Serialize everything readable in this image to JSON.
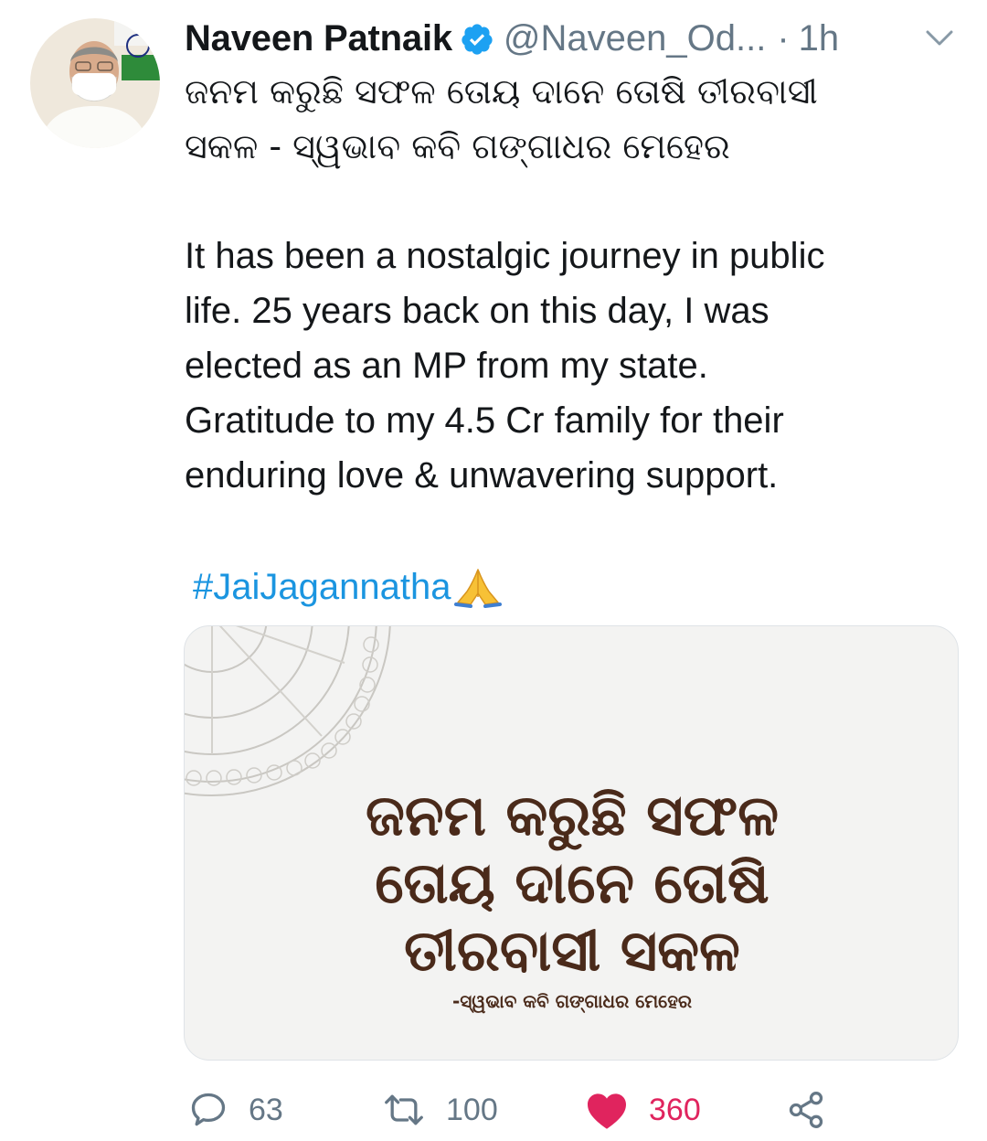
{
  "author": {
    "name": "Naveen Patnaik",
    "handle": "@Naveen_Od...",
    "separator": "·",
    "time": "1h",
    "verified": true
  },
  "tweet": {
    "odia_lines": [
      "ଜନମ କରୁଛି ସଫଳ ତୋୟ ଦାନେ ତୋଷି ତୀରବାସୀ",
      "ସକଳ - ସ୍ୱଭାବ କବି ଗଙ୍ଗାଧର ମେହେର"
    ],
    "english_lines": [
      "It has been a nostalgic journey in public",
      "life. 25 years back on this day, I was",
      "elected as an MP from my state.",
      "Gratitude to my 4.5 Cr family for their",
      "enduring love & unwavering support."
    ],
    "hashtag": "#JaiJagannatha"
  },
  "media": {
    "lines": [
      "ଜନମ କରୁଛି ସଫଳ",
      "ତୋୟ ଦାନେ ତୋଷି",
      "ତୀରବାସୀ ସକଳ"
    ],
    "attribution": "-ସ୍ୱଭାବ କବି ଗଙ୍ଗାଧର ମେହେର"
  },
  "actions": {
    "reply_count": "63",
    "retweet_count": "100",
    "like_count": "360",
    "liked": true
  },
  "colors": {
    "link": "#1b95e0",
    "like": "#e0245e",
    "muted": "#657786",
    "verified": "#1da1f2"
  }
}
